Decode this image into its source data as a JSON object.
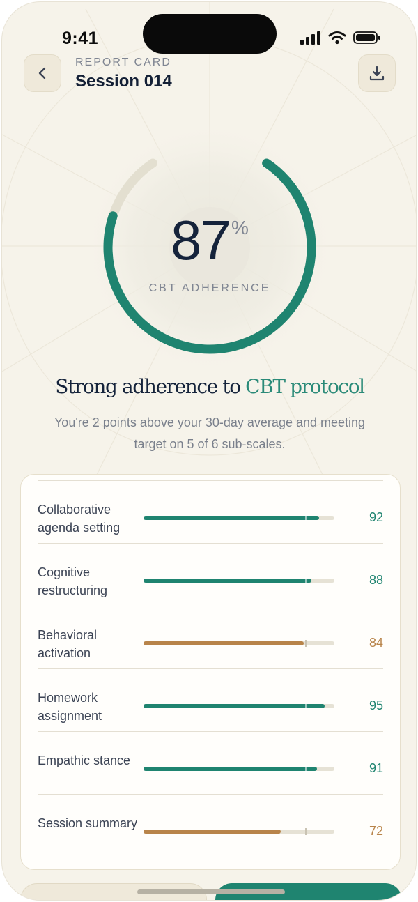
{
  "status": {
    "time": "9:41"
  },
  "header": {
    "eyebrow": "REPORT CARD",
    "title": "Session 014"
  },
  "gauge": {
    "value": "87",
    "unit": "%",
    "label": "CBT ADHERENCE",
    "fraction": 0.87
  },
  "headline": {
    "prefix": "Strong adherence to ",
    "accent": "CBT protocol"
  },
  "subtext": "You're 2 points above your 30-day average and meeting target on 5 of 6 sub-scales.",
  "colors": {
    "accent": "#1f8470",
    "warn": "#b8844a",
    "track": "#e6e2d5",
    "background": "#f6f3ea"
  },
  "target": 85,
  "subscales": [
    {
      "label": "Collaborative agenda setting",
      "value": 92,
      "status": "good"
    },
    {
      "label": "Cognitive restructuring",
      "value": 88,
      "status": "good"
    },
    {
      "label": "Behavioral activation",
      "value": 84,
      "status": "warn"
    },
    {
      "label": "Homework assignment",
      "value": 95,
      "status": "good"
    },
    {
      "label": "Empathic stance",
      "value": 91,
      "status": "good"
    },
    {
      "label": "Session summary",
      "value": 72,
      "status": "warn"
    }
  ],
  "icons": {
    "back": "chevron-left-icon",
    "download": "download-icon"
  }
}
